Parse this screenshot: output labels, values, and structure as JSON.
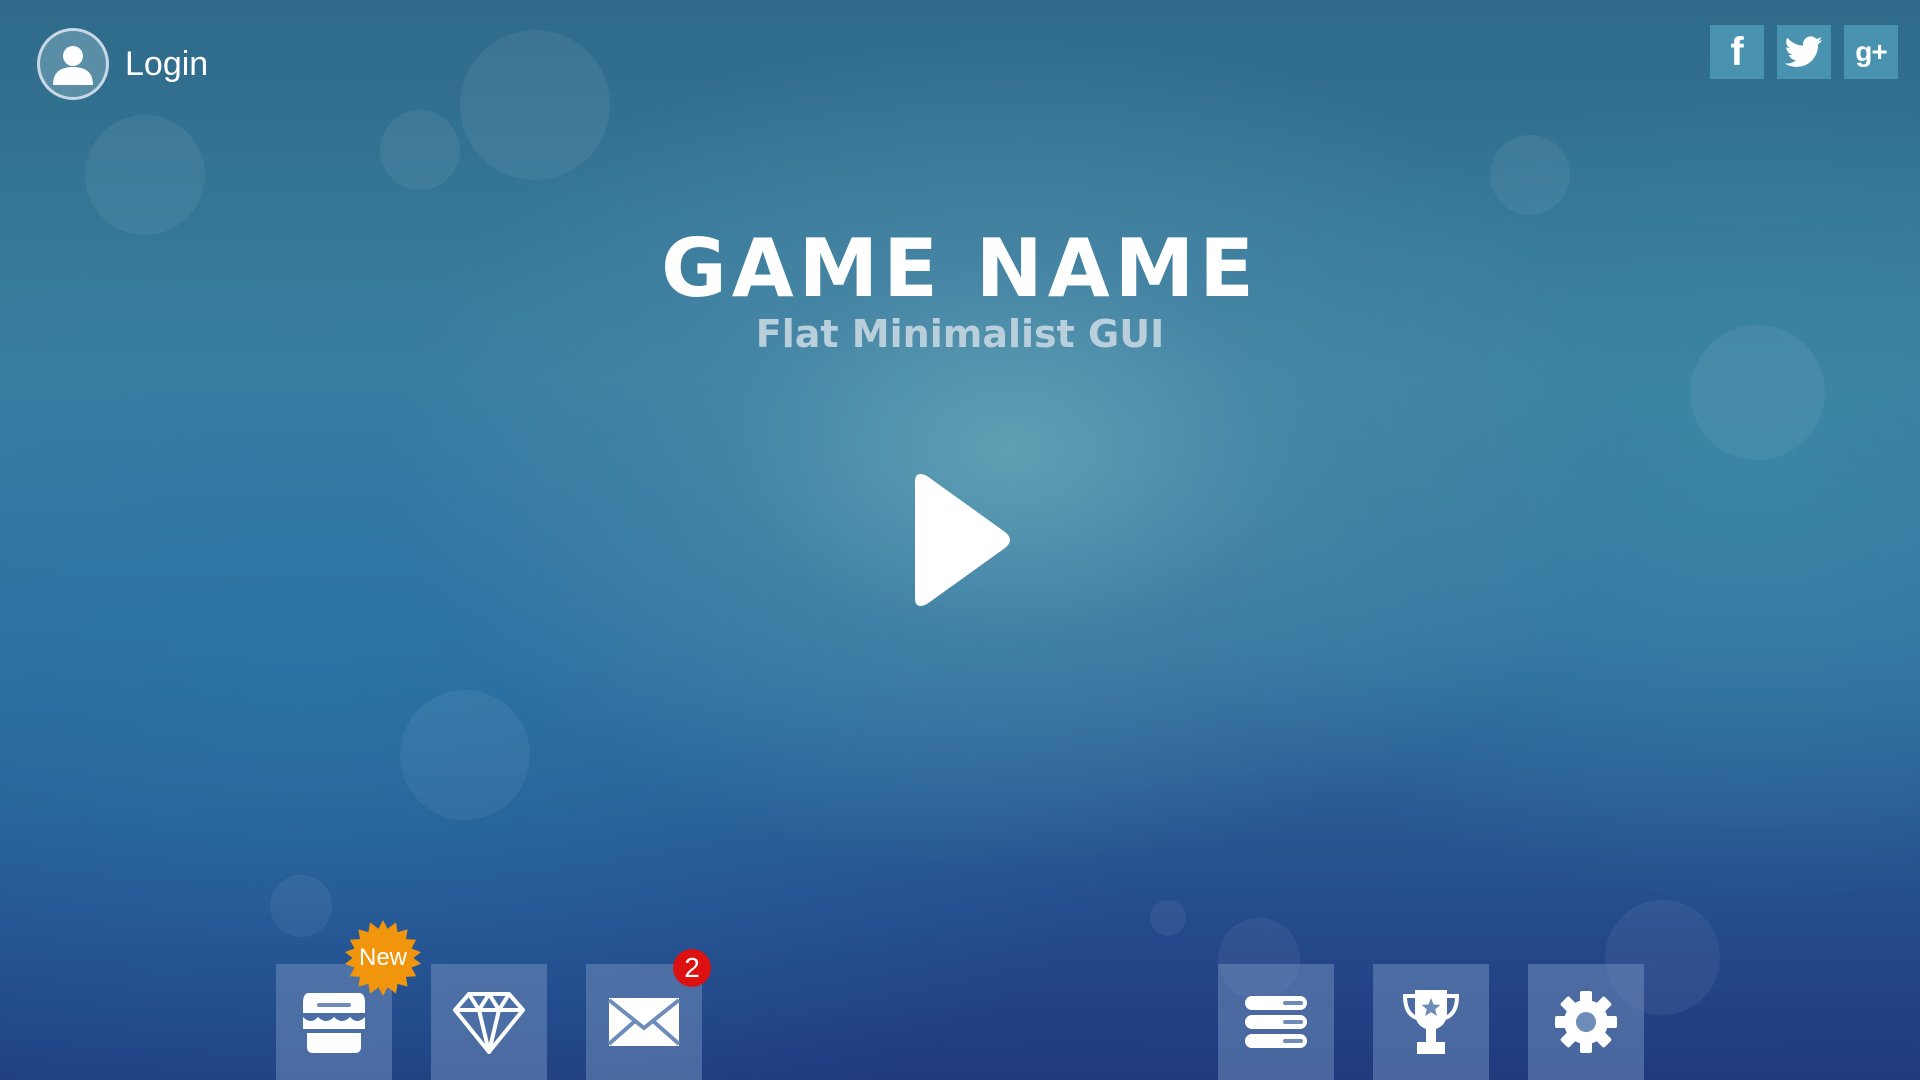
{
  "login": {
    "label": "Login",
    "icon": "user-icon"
  },
  "social": [
    {
      "name": "facebook",
      "glyph": "f",
      "icon": "facebook-icon"
    },
    {
      "name": "twitter",
      "glyph": "",
      "icon": "twitter-icon"
    },
    {
      "name": "google-plus",
      "glyph": "g+",
      "icon": "google-plus-icon"
    }
  ],
  "title": "GAME NAME",
  "subtitle": "Flat Minimalist GUI",
  "play": {
    "icon": "play-icon"
  },
  "bottom_left": [
    {
      "name": "shop",
      "icon": "shop-icon",
      "badge": "New"
    },
    {
      "name": "gems",
      "icon": "diamond-icon"
    },
    {
      "name": "mail",
      "icon": "envelope-icon",
      "badge": "2"
    }
  ],
  "bottom_right": [
    {
      "name": "leaderboard",
      "icon": "list-icon"
    },
    {
      "name": "achievements",
      "icon": "trophy-icon"
    },
    {
      "name": "settings",
      "icon": "gear-icon"
    }
  ],
  "colors": {
    "badge_new": "#f0950c",
    "badge_count": "#dd1111",
    "social_bg": "#4a93b0"
  }
}
